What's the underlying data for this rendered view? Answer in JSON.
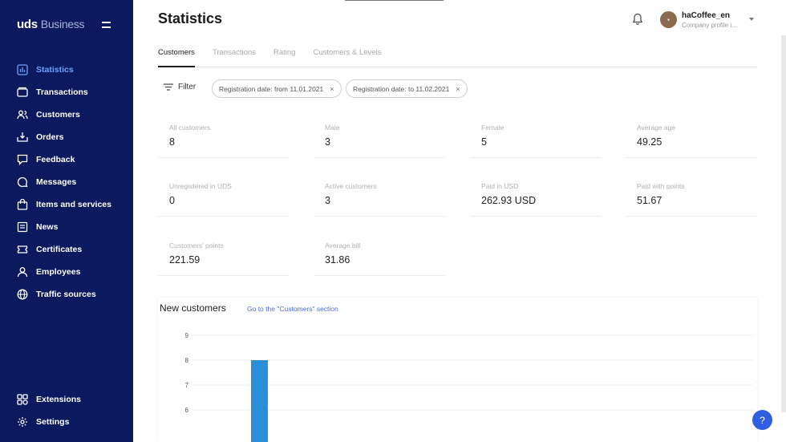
{
  "brand": {
    "name": "uds",
    "sub": "Business"
  },
  "sidebar": {
    "items": [
      {
        "label": "Statistics",
        "icon": "chart-icon",
        "active": true
      },
      {
        "label": "Transactions",
        "icon": "wallet-icon"
      },
      {
        "label": "Customers",
        "icon": "users-icon"
      },
      {
        "label": "Orders",
        "icon": "orders-icon"
      },
      {
        "label": "Feedback",
        "icon": "feedback-icon"
      },
      {
        "label": "Messages",
        "icon": "chat-icon"
      },
      {
        "label": "Items and services",
        "icon": "bag-icon"
      },
      {
        "label": "News",
        "icon": "news-icon"
      },
      {
        "label": "Certificates",
        "icon": "ticket-icon"
      },
      {
        "label": "Employees",
        "icon": "person-icon"
      },
      {
        "label": "Traffic sources",
        "icon": "globe-icon"
      }
    ],
    "bottom": [
      {
        "label": "Extensions",
        "icon": "puzzle-icon"
      },
      {
        "label": "Settings",
        "icon": "gear-icon"
      }
    ]
  },
  "header": {
    "title": "Statistics",
    "profile_name": "haCoffee_en",
    "profile_sub": "Company profile i..."
  },
  "tabs": [
    "Customers",
    "Transactions",
    "Rating",
    "Customers & Levels"
  ],
  "filter": {
    "label": "Filter",
    "chips": [
      "Registration date: from 11.01.2021",
      "Registration date: to 11.02.2021"
    ]
  },
  "stats": [
    {
      "label": "All customers",
      "value": "8"
    },
    {
      "label": "Male",
      "value": "3"
    },
    {
      "label": "Female",
      "value": "5"
    },
    {
      "label": "Average age",
      "value": "49.25"
    },
    {
      "label": "Unregistered in UDS",
      "value": "0"
    },
    {
      "label": "Active customers",
      "value": "3"
    },
    {
      "label": "Paid in USD",
      "value": "262.93 USD"
    },
    {
      "label": "Paid with points",
      "value": "51.67"
    },
    {
      "label": "Customers' points",
      "value": "221.59"
    },
    {
      "label": "Average bill",
      "value": "31.86"
    }
  ],
  "chart_section": {
    "title": "New customers",
    "link": "Go to the \"Customers\" section"
  },
  "chart_data": {
    "type": "bar",
    "title": "",
    "ylabel": "",
    "yticks": [
      6,
      7,
      8,
      9
    ],
    "ylim_visible": [
      6,
      9
    ],
    "values": [
      8
    ],
    "bar_color": "#2a8fd6"
  },
  "help": "?",
  "colors": {
    "sidebar": "#0b1a5e",
    "active": "#6ea2ff",
    "accent": "#2f5fe0"
  }
}
